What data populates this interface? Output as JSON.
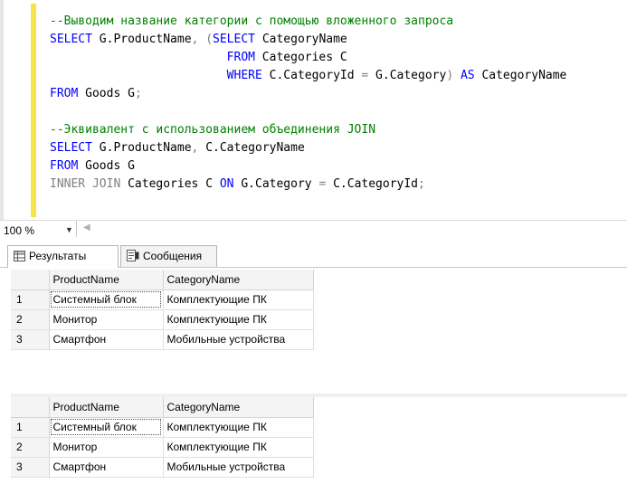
{
  "editor": {
    "lines": [
      [
        {
          "t": "--Выводим название категории с помощью вложенного запроса",
          "c": "cm"
        }
      ],
      [
        {
          "t": "SELECT",
          "c": "kw"
        },
        {
          "t": " G.ProductName",
          "c": "pl"
        },
        {
          "t": ", (",
          "c": "gr"
        },
        {
          "t": "SELECT",
          "c": "kw"
        },
        {
          "t": " CategoryName",
          "c": "pl"
        }
      ],
      [
        {
          "t": "                         ",
          "c": "pl"
        },
        {
          "t": "FROM",
          "c": "kw"
        },
        {
          "t": " Categories C",
          "c": "pl"
        }
      ],
      [
        {
          "t": "                         ",
          "c": "pl"
        },
        {
          "t": "WHERE",
          "c": "kw"
        },
        {
          "t": " C.CategoryId ",
          "c": "pl"
        },
        {
          "t": "=",
          "c": "gr"
        },
        {
          "t": " G.Category",
          "c": "pl"
        },
        {
          "t": ")",
          "c": "gr"
        },
        {
          "t": " ",
          "c": "pl"
        },
        {
          "t": "AS",
          "c": "kw"
        },
        {
          "t": " CategoryName",
          "c": "pl"
        }
      ],
      [
        {
          "t": "FROM",
          "c": "kw"
        },
        {
          "t": " Goods G",
          "c": "pl"
        },
        {
          "t": ";",
          "c": "gr"
        }
      ],
      [
        {
          "t": "",
          "c": "pl"
        }
      ],
      [
        {
          "t": "--Эквивалент с использованием объединения JOIN",
          "c": "cm"
        }
      ],
      [
        {
          "t": "SELECT",
          "c": "kw"
        },
        {
          "t": " G.ProductName",
          "c": "pl"
        },
        {
          "t": ",",
          "c": "gr"
        },
        {
          "t": " C.CategoryName",
          "c": "pl"
        }
      ],
      [
        {
          "t": "FROM",
          "c": "kw"
        },
        {
          "t": " Goods G",
          "c": "pl"
        }
      ],
      [
        {
          "t": "INNER JOIN",
          "c": "gr"
        },
        {
          "t": " Categories C ",
          "c": "pl"
        },
        {
          "t": "ON",
          "c": "kw"
        },
        {
          "t": " G.Category ",
          "c": "pl"
        },
        {
          "t": "=",
          "c": "gr"
        },
        {
          "t": " C.CategoryId",
          "c": "pl"
        },
        {
          "t": ";",
          "c": "gr"
        }
      ]
    ]
  },
  "zoom": {
    "value": "100 %"
  },
  "tabs": {
    "results_label": "Результаты",
    "messages_label": "Сообщения"
  },
  "grids": [
    {
      "columns": [
        "ProductName",
        "CategoryName"
      ],
      "rows": [
        {
          "num": "1",
          "cells": [
            "Системный блок",
            "Комплектующие ПК"
          ]
        },
        {
          "num": "2",
          "cells": [
            "Монитор",
            "Комплектующие ПК"
          ]
        },
        {
          "num": "3",
          "cells": [
            "Смартфон",
            "Мобильные устройства"
          ]
        }
      ]
    },
    {
      "columns": [
        "ProductName",
        "CategoryName"
      ],
      "rows": [
        {
          "num": "1",
          "cells": [
            "Системный блок",
            "Комплектующие ПК"
          ]
        },
        {
          "num": "2",
          "cells": [
            "Монитор",
            "Комплектующие ПК"
          ]
        },
        {
          "num": "3",
          "cells": [
            "Смартфон",
            "Мобильные устройства"
          ]
        }
      ]
    }
  ],
  "colors": {
    "keyword": "#0000ff",
    "comment": "#008000",
    "operator": "#808080",
    "change_bar": "#f7e34a"
  }
}
